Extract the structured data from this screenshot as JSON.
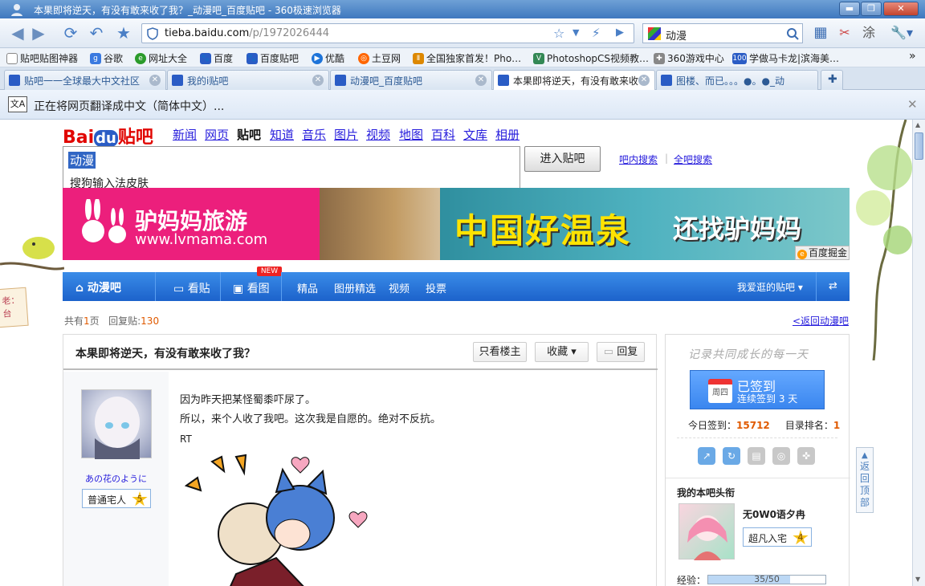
{
  "window": {
    "title": "本果即将逆天，有没有敢来收了我？_动漫吧_百度贴吧 - 360极速浏览器"
  },
  "navbar": {
    "url_domain": "tieba.baidu.com",
    "url_path": "/p/1972026444",
    "search_query": "动漫"
  },
  "bookmarks": [
    {
      "label": "贴吧贴图神器",
      "icon": "document-icon"
    },
    {
      "label": "谷歌",
      "icon": "google-icon"
    },
    {
      "label": "网址大全",
      "icon": "site-nav-icon"
    },
    {
      "label": "百度",
      "icon": "baidu-paw-icon"
    },
    {
      "label": "百度贴吧",
      "icon": "baidu-paw-icon"
    },
    {
      "label": "优酷",
      "icon": "play-icon"
    },
    {
      "label": "土豆网",
      "icon": "tudou-icon"
    },
    {
      "label": "全国独家首发！Pho…",
      "icon": "news-icon"
    },
    {
      "label": "PhotoshopCS视频教…",
      "icon": "ps-icon"
    },
    {
      "label": "360游戏中心",
      "icon": "gamepad-icon"
    },
    {
      "label": "学做马卡龙|滨海美…",
      "icon": "baidu-100-icon"
    }
  ],
  "tabs": [
    {
      "label": "贴吧一一全球最大中文社区"
    },
    {
      "label": "我的i贴吧"
    },
    {
      "label": "动漫吧_百度贴吧"
    },
    {
      "label": "本果即将逆天，有没有敢来收"
    },
    {
      "label": "图楼、而已。。。●。●_动"
    }
  ],
  "translate_bar": {
    "message": "正在将网页翻译成中文（简体中文）..."
  },
  "baidu_nav": {
    "logo_bai": "Bai",
    "logo_du": "du",
    "logo_tieba": "贴吧",
    "links": [
      "新闻",
      "网页",
      "贴吧",
      "知道",
      "音乐",
      "图片",
      "视频",
      "地图",
      "百科",
      "文库",
      "相册"
    ]
  },
  "tieba_search": {
    "value": "动漫",
    "suggestion": "搜狗输入法皮肤",
    "enter_button": "进入贴吧",
    "inbar_search": "吧内搜索",
    "all_search": "全吧搜索"
  },
  "banner": {
    "brand": "驴妈妈旅游",
    "brand_url": "www.lvmama.com",
    "headline": "中国好温泉",
    "headline2": "还找驴妈妈",
    "ad_tag": "百度掘金"
  },
  "bar_nav": {
    "home": "动漫吧",
    "posts": "看贴",
    "pics": "看图",
    "new_badge": "NEW",
    "items": [
      "精品",
      "图册精选",
      "视频",
      "投票"
    ],
    "my_bars": "我爱逛的贴吧"
  },
  "page_meta": {
    "total_prefix": "共有",
    "total_pages": "1",
    "total_suffix": "页",
    "replies_prefix": "回复贴:",
    "replies": "130",
    "back_link": "<返回动漫吧"
  },
  "post": {
    "title": "本果即将逆天，有没有敢来收了我？",
    "only_op": "只看楼主",
    "favorite": "收藏",
    "reply": "回复",
    "author_name": "あの花のように",
    "author_badge": "普通宅人",
    "author_level": "5",
    "lines": [
      "因为昨天把某怪蜀黍吓尿了。",
      "所以，来个人收了我吧。这次我是自愿的。绝对不反抗。",
      "RT"
    ]
  },
  "sidebar": {
    "slogan": "记录共同成长的每一天",
    "weekday": "周四",
    "signed": "已签到",
    "streak": "连续签到 3 天",
    "today_label": "今日签到：",
    "today_count": "15712",
    "rank_label": "目录排名：",
    "rank": "1",
    "title_header": "我的本吧头衔",
    "member_name": "无0W0语夕冉",
    "member_badge": "超凡入宅",
    "member_level": "4",
    "exp_label": "经验：",
    "exp_text": "35/50",
    "exp_fraction": 0.7
  },
  "left_edge_label": "老：",
  "left_edge_label2": "台",
  "back_to_top": "返回顶部"
}
